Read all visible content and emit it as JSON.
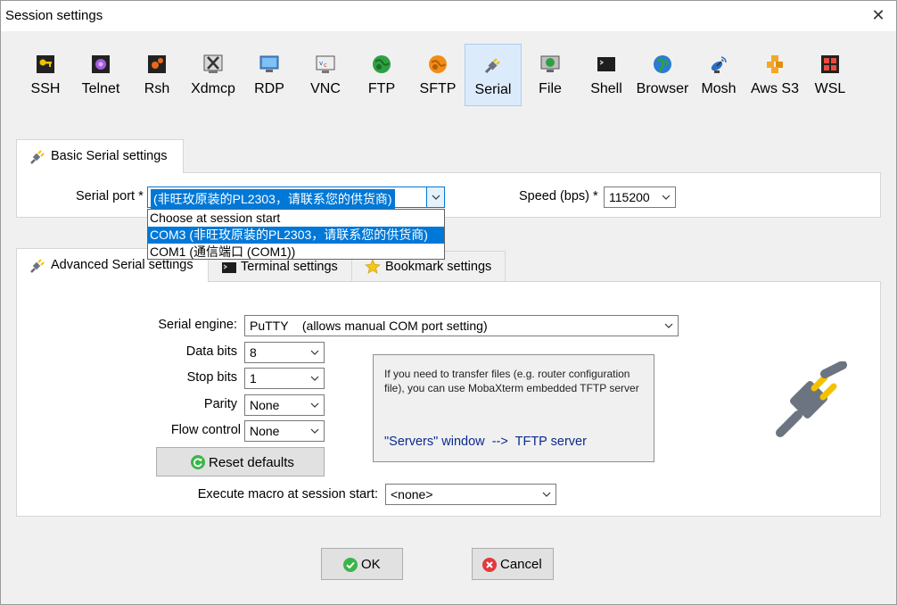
{
  "window": {
    "title": "Session settings",
    "close": "✕"
  },
  "session_types": [
    {
      "label": "SSH",
      "icon": "ssh-key-icon"
    },
    {
      "label": "Telnet",
      "icon": "telnet-icon"
    },
    {
      "label": "Rsh",
      "icon": "rsh-icon"
    },
    {
      "label": "Xdmcp",
      "icon": "xdmcp-icon"
    },
    {
      "label": "RDP",
      "icon": "rdp-monitor-icon"
    },
    {
      "label": "VNC",
      "icon": "vnc-icon"
    },
    {
      "label": "FTP",
      "icon": "ftp-globe-icon"
    },
    {
      "label": "SFTP",
      "icon": "sftp-icon"
    },
    {
      "label": "Serial",
      "icon": "serial-plug-icon",
      "selected": true
    },
    {
      "label": "File",
      "icon": "file-monitor-icon"
    },
    {
      "label": "Shell",
      "icon": "shell-terminal-icon"
    },
    {
      "label": "Browser",
      "icon": "browser-globe-icon"
    },
    {
      "label": "Mosh",
      "icon": "mosh-satellite-icon"
    },
    {
      "label": "Aws S3",
      "icon": "aws-s3-icon"
    },
    {
      "label": "WSL",
      "icon": "wsl-windows-icon"
    }
  ],
  "basic": {
    "tab_label": "Basic Serial settings",
    "serial_port_label": "Serial port *",
    "serial_port_value": "(非旺玫原装的PL2303，请联系您的供货商)",
    "dropdown_options": [
      "Choose at session start",
      "COM3  (非旺玫原装的PL2303，请联系您的供货商)",
      "COM1  (通信端口 (COM1))"
    ],
    "dropdown_selected_index": 1,
    "speed_label": "Speed (bps) *",
    "speed_value": "115200"
  },
  "tabs": [
    {
      "label": "Advanced Serial settings",
      "active": true
    },
    {
      "label": "Terminal settings"
    },
    {
      "label": "Bookmark settings"
    }
  ],
  "advanced": {
    "serial_engine_label": "Serial engine:",
    "serial_engine_value": "PuTTY    (allows manual COM port setting)",
    "data_bits_label": "Data bits",
    "data_bits_value": "8",
    "stop_bits_label": "Stop bits",
    "stop_bits_value": "1",
    "parity_label": "Parity",
    "parity_value": "None",
    "flow_control_label": "Flow control",
    "flow_control_value": "None",
    "reset_label": "Reset defaults",
    "macro_label": "Execute macro at session start:",
    "macro_value": "<none>",
    "info_text": "If you need to transfer files (e.g. router configuration file), you can use MobaXterm embedded TFTP server",
    "info_link": "\"Servers\" window  -->  TFTP server"
  },
  "footer": {
    "ok_label": "OK",
    "cancel_label": "Cancel"
  },
  "colors": {
    "accent": "#0078d7",
    "selected_tile": "#dcebfc",
    "link": "#0b2a8c",
    "ok_green": "#3bb54a",
    "cancel_red": "#e0393e"
  }
}
